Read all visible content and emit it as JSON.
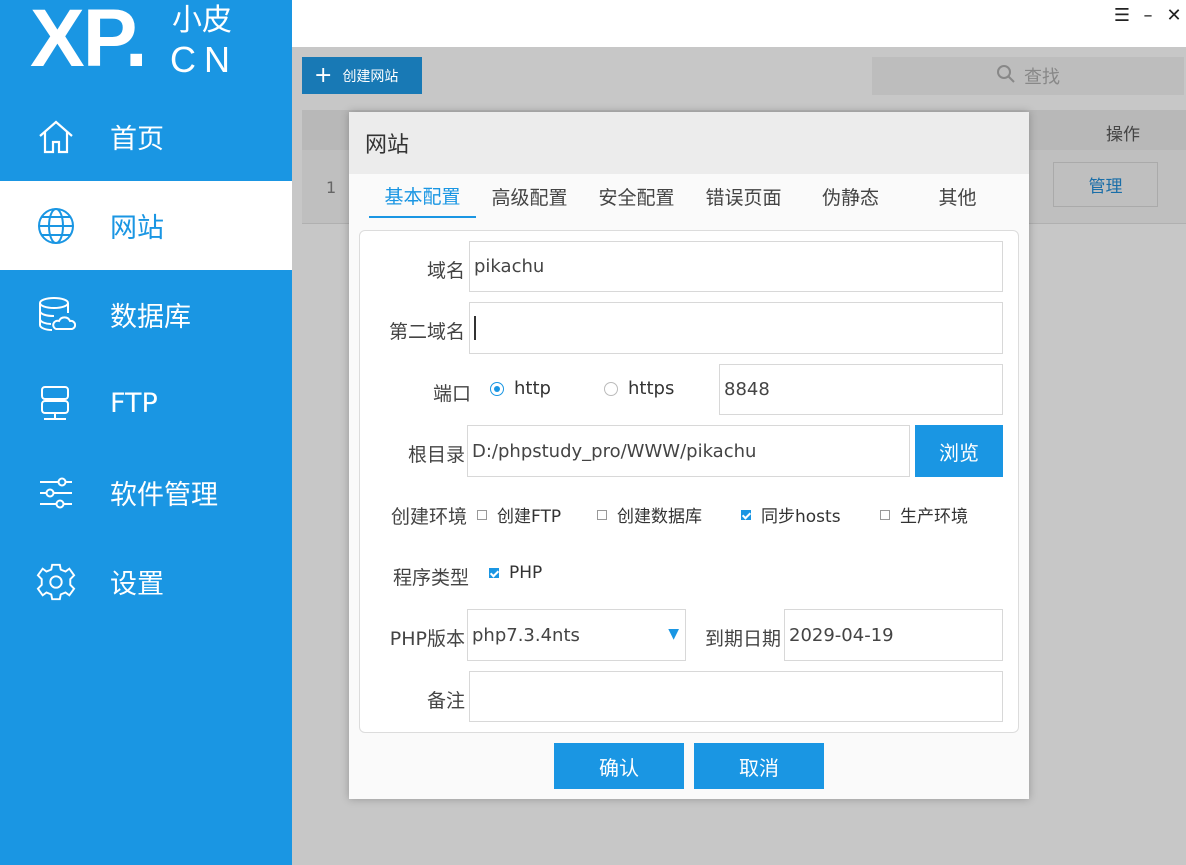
{
  "sidebar": {
    "logo": {
      "main": "XP.",
      "top": "小皮",
      "bottom": "CN"
    },
    "items": [
      {
        "label": "首页",
        "icon": "home-icon"
      },
      {
        "label": "网站",
        "icon": "globe-icon"
      },
      {
        "label": "数据库",
        "icon": "database-icon"
      },
      {
        "label": "FTP",
        "icon": "ftp-icon"
      },
      {
        "label": "软件管理",
        "icon": "sliders-icon"
      },
      {
        "label": "设置",
        "icon": "gear-icon"
      }
    ],
    "active_item": "网站"
  },
  "window_controls": {
    "menu": "☰",
    "minimize": "–",
    "close": "✕"
  },
  "toolbar": {
    "create_label": "创建网站",
    "search_placeholder": "查找"
  },
  "table": {
    "headers": {
      "operation": "操作"
    },
    "rows": [
      {
        "num": "1",
        "action": "管理"
      }
    ]
  },
  "dialog": {
    "title": "网站",
    "tabs": [
      "基本配置",
      "高级配置",
      "安全配置",
      "错误页面",
      "伪静态",
      "其他"
    ],
    "active_tab": "基本配置",
    "form": {
      "domain_label": "域名",
      "domain_value": "pikachu",
      "second_domain_label": "第二域名",
      "second_domain_value": "",
      "port_label": "端口",
      "protocol_http": "http",
      "protocol_https": "https",
      "protocol_selected": "http",
      "port_value": "8848",
      "root_label": "根目录",
      "root_value": "D:/phpstudy_pro/WWW/pikachu",
      "browse_label": "浏览",
      "env_label": "创建环境",
      "env_options": [
        {
          "label": "创建FTP",
          "checked": false
        },
        {
          "label": "创建数据库",
          "checked": false
        },
        {
          "label": "同步hosts",
          "checked": true
        },
        {
          "label": "生产环境",
          "checked": false
        }
      ],
      "program_type_label": "程序类型",
      "program_type_option": {
        "label": "PHP",
        "checked": true
      },
      "php_version_label": "PHP版本",
      "php_version_value": "php7.3.4nts",
      "expire_label": "到期日期",
      "expire_value": "2029-04-19",
      "note_label": "备注",
      "note_value": ""
    },
    "confirm_label": "确认",
    "cancel_label": "取消"
  },
  "colors": {
    "brand": "#1a96e3",
    "create_button": "#1879b5",
    "overlay": "#c7c7c7"
  }
}
